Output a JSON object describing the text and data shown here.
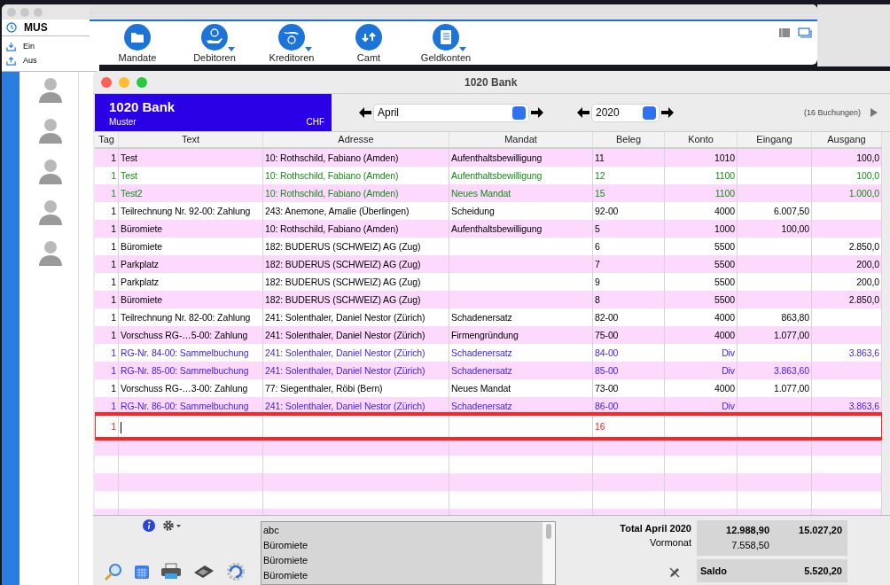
{
  "sidebar_window": {
    "account": "MUS",
    "items": [
      {
        "label": "Ein",
        "kind": "in"
      },
      {
        "label": "Aus",
        "kind": "out"
      }
    ],
    "contacts": [
      {
        "kind": "person"
      },
      {
        "kind": "person"
      },
      {
        "kind": "person"
      },
      {
        "kind": "person"
      },
      {
        "kind": "person"
      }
    ]
  },
  "toolbar": {
    "buttons": [
      {
        "label": "Mandate",
        "kind": "folder",
        "dropdown": false
      },
      {
        "label": "Debitoren",
        "kind": "coin-hand",
        "dropdown": true
      },
      {
        "label": "Kreditoren",
        "kind": "hand-coin",
        "dropdown": true
      },
      {
        "label": "Camt",
        "kind": "swap",
        "dropdown": false
      },
      {
        "label": "Geldkonten",
        "kind": "ledger",
        "dropdown": true
      }
    ]
  },
  "window": {
    "title": "1020 Bank"
  },
  "account_header": {
    "title": "1020 Bank",
    "subtitle": "Muster",
    "currency": "CHF"
  },
  "period": {
    "month": "April",
    "year": "2020",
    "count": "(16 Buchungen)"
  },
  "table": {
    "columns": [
      "Tag",
      "Text",
      "Adresse",
      "Mandat",
      "Beleg",
      "Konto",
      "Eingang",
      "Ausgang"
    ],
    "rows": [
      {
        "color": "#000000",
        "cells": [
          "1",
          "Test",
          "10: Rothschild, Fabiano (Amden)",
          "Aufenthaltsbewilligung",
          "11",
          "1010",
          "",
          "100,0"
        ]
      },
      {
        "color": "#178a17",
        "cells": [
          "1",
          "Test",
          "10: Rothschild, Fabiano (Amden)",
          "Aufenthaltsbewilligung",
          "12",
          "1100",
          "",
          "100,0"
        ]
      },
      {
        "color": "#178a17",
        "cells": [
          "1",
          "Test2",
          "10: Rothschild, Fabiano (Amden)",
          "Neues Mandat",
          "15",
          "1100",
          "",
          "1.000,0"
        ]
      },
      {
        "color": "#000000",
        "cells": [
          "1",
          "Teilrechnung Nr. 92-00: Zahlung",
          "243: Anemone, Amalie (Überlingen)",
          "Scheidung",
          "92-00",
          "4000",
          "6.007,50",
          ""
        ]
      },
      {
        "color": "#000000",
        "cells": [
          "1",
          "Büromiete",
          "10: Rothschild, Fabiano (Amden)",
          "Aufenthaltsbewilligung",
          "5",
          "1000",
          "100,00",
          ""
        ]
      },
      {
        "color": "#000000",
        "cells": [
          "1",
          "Büromiete",
          "182: BUDERUS (SCHWEIZ) AG (Zug)",
          "",
          "6",
          "5500",
          "",
          "2.850,0"
        ]
      },
      {
        "color": "#000000",
        "cells": [
          "1",
          "Parkplatz",
          "182: BUDERUS (SCHWEIZ) AG (Zug)",
          "",
          "7",
          "5500",
          "",
          "200,0"
        ]
      },
      {
        "color": "#000000",
        "cells": [
          "1",
          "Parkplatz",
          "182: BUDERUS (SCHWEIZ) AG (Zug)",
          "",
          "9",
          "5500",
          "",
          "200,0"
        ]
      },
      {
        "color": "#000000",
        "cells": [
          "1",
          "Büromiete",
          "182: BUDERUS (SCHWEIZ) AG (Zug)",
          "",
          "8",
          "5500",
          "",
          "2.850,0"
        ]
      },
      {
        "color": "#000000",
        "cells": [
          "1",
          "Teilrechnung Nr. 82-00: Zahlung",
          "241: Solenthaler, Daniel Nestor (Zürich)",
          "Schadenersatz",
          "82-00",
          "4000",
          "863,80",
          ""
        ]
      },
      {
        "color": "#000000",
        "cells": [
          "1",
          "Vorschuss RG-…5-00: Zahlung",
          "241: Solenthaler, Daniel Nestor (Zürich)",
          "Firmengründung",
          "75-00",
          "4000",
          "1.077,00",
          ""
        ]
      },
      {
        "color": "#3b1fe6",
        "cells": [
          "1",
          "RG-Nr. 84-00: Sammelbuchung",
          "241: Solenthaler, Daniel Nestor (Zürich)",
          "Schadenersatz",
          "84-00",
          "Div",
          "",
          "3.863,6"
        ]
      },
      {
        "color": "#3b1fe6",
        "cells": [
          "1",
          "RG-Nr. 85-00: Sammelbuchung",
          "241: Solenthaler, Daniel Nestor (Zürich)",
          "Schadenersatz",
          "85-00",
          "Div",
          "3.863,60",
          ""
        ]
      },
      {
        "color": "#000000",
        "cells": [
          "1",
          "Vorschuss RG-…3-00: Zahlung",
          "77: Siegenthaler, Röbi (Bern)",
          "Neues Mandat",
          "73-00",
          "4000",
          "1.077,00",
          ""
        ]
      },
      {
        "color": "#3b1fe6",
        "cells": [
          "1",
          "RG-Nr. 86-00: Sammelbuchung",
          "241: Solenthaler, Daniel Nestor (Zürich)",
          "Schadenersatz",
          "86-00",
          "Div",
          "",
          "3.863,6"
        ]
      }
    ],
    "new_row": {
      "tag": "1",
      "beleg": "16",
      "highlighted": true
    }
  },
  "memo_list": {
    "items": [
      "abc",
      "Büromiete",
      "Büromiete",
      "Büromiete"
    ]
  },
  "totals": {
    "label": "Total April 2020",
    "eingang": "12.988,90",
    "ausgang": "15.027,20",
    "previous_label": "Vormonat",
    "previous_eingang": "7.558,50",
    "balance_label": "Saldo",
    "balance": "5.520,20"
  }
}
